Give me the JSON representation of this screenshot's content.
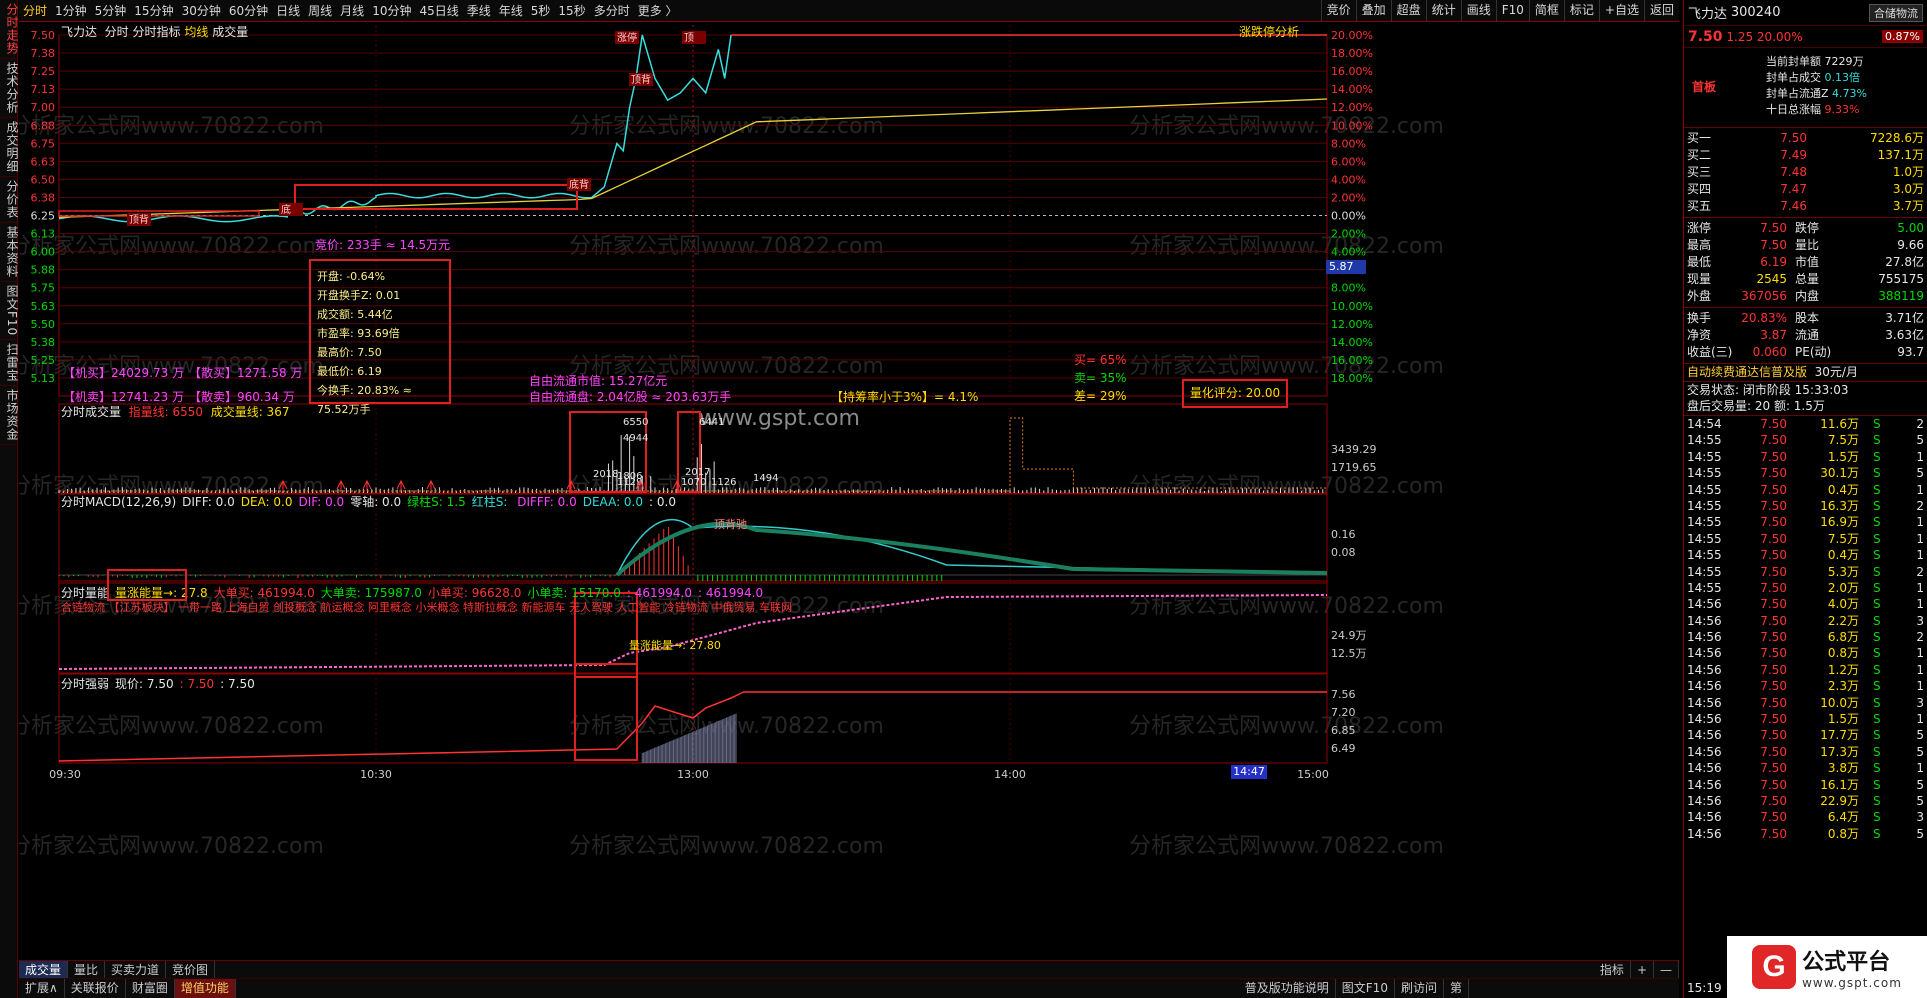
{
  "left_tabs": [
    "分时走势",
    "技术分析",
    "成交明细",
    "分价表",
    "基本资料",
    "图文F10",
    "扫雷宝",
    "市场资金"
  ],
  "toolbar": {
    "periods": [
      "分时",
      "1分钟",
      "5分钟",
      "15分钟",
      "30分钟",
      "60分钟",
      "日线",
      "周线",
      "月线",
      "10分钟",
      "45日线",
      "季线",
      "年线",
      "5秒",
      "15秒",
      "多分时",
      "更多 〉"
    ],
    "right_buttons": [
      "竞价",
      "叠加",
      "超盘",
      "统计",
      "画线",
      "F10",
      "简框",
      "标记",
      "+自选",
      "返回"
    ]
  },
  "price_panel": {
    "title_items": [
      "飞力达",
      "分时",
      "分时指标",
      "均线",
      "成交量"
    ],
    "corner_label": "涨跌停分析",
    "y_prices": [
      "7.50",
      "7.38",
      "7.25",
      "7.13",
      "7.00",
      "6.88",
      "6.75",
      "6.63",
      "6.50",
      "6.38",
      "6.25",
      "6.13",
      "6.00",
      "5.88",
      "5.75",
      "5.63",
      "5.50",
      "5.38",
      "5.25",
      "5.13"
    ],
    "y_pcts": [
      "20.00%",
      "18.00%",
      "16.00%",
      "14.00%",
      "12.00%",
      "10.00%",
      "8.00%",
      "6.00%",
      "4.00%",
      "2.00%",
      "0.00%",
      "2.00%",
      "4.00%",
      "6.00%",
      "8.00%",
      "10.00%",
      "12.00%",
      "14.00%",
      "16.00%",
      "18.00%"
    ],
    "current_tag": "5.87",
    "bid_label": "竞价: 233手 ≈ 14.5万元",
    "info_box": [
      "开盘: -0.64%",
      "开盘换手Z: 0.01",
      "成交额: 5.44亿",
      "市盈率: 93.69倍",
      "最高价: 7.50",
      "最低价: 6.19",
      "今换手: 20.83% ≈ 75.52万手"
    ],
    "jimai": "【机买】24029.73 万",
    "sanmai": "【散买】1271.58 万",
    "jimai2": "【机卖】12741.23 万",
    "sanmai2": "【散卖】960.34 万",
    "float_mv": "自由流通市值: 15.27亿元",
    "float_shares": "自由流通盘: 2.04亿股 ≈ 203.63万手",
    "ratio_text": "【持筹率小于3%】= 4.1%",
    "buy_pct": "买= 65%",
    "sell_pct": "卖= 35%",
    "diff_pct": "差= 29%",
    "score": "量化评分: 20.00",
    "markers": [
      "顶背",
      "底",
      "底背",
      "涨停",
      "顶背",
      "顶"
    ]
  },
  "volume_panel": {
    "title": "分时成交量",
    "vol_a": "指量线: 6550",
    "vol_b": "成交量线: 367",
    "y_labels": [
      "3439.29",
      "1719.65"
    ],
    "bar_labels": [
      "6550",
      "4944",
      "2018",
      "1806",
      "2017",
      "1070",
      "1126",
      "1494",
      "6441",
      "1129"
    ]
  },
  "macd_panel": {
    "title": "分时MACD(12,26,9)",
    "items": [
      "DIFF: 0.0",
      "DEA: 0.0",
      "DIF: 0.0",
      "零轴: 0.0",
      "绿柱S: 1.5",
      "红柱S: ",
      "DIFFF: 0.0",
      "DEAA: 0.0",
      ": 0.0"
    ],
    "y_labels": [
      "0.16",
      "0.08"
    ],
    "marker": "顶背驰"
  },
  "energy_panel": {
    "title": "分时量能",
    "items": [
      "量涨能量→: 27.8",
      "大单买: 461994.0",
      "大单卖: 175987.0",
      "小单买: 96628.0",
      "小单卖: 15170.0",
      ": 461994.0",
      ": 461994.0"
    ],
    "concepts": "合链物流 【江苏板块】 一带一路 上海自贸 创投概念 航运概念 阿里概念 小米概念 特斯拉概念 新能源车 无人驾驶 人工智能 冷链物流 中俄贸易 车联网",
    "marker": "量涨能量→: 27.80",
    "y_labels": [
      "24.9万",
      "12.5万"
    ]
  },
  "strength_panel": {
    "title": "分时强弱",
    "items": [
      "现价: 7.50",
      ": 7.50",
      ": 7.50"
    ],
    "y_labels": [
      "7.56",
      "7.20",
      "6.85",
      "6.49"
    ]
  },
  "time_axis": [
    "09:30",
    "10:30",
    "13:00",
    "14:00",
    "15:00"
  ],
  "cursor_time": "14:47",
  "watermark": "分析家公式网www.70822.com",
  "watermark2": "www.gspt.com",
  "right_panel": {
    "stock_name": "飞力达",
    "stock_code": "300240",
    "sector": "合储物流",
    "price": "7.50",
    "change": "1.25",
    "pct": "20.00%",
    "sector_pct": "0.87%",
    "board_tag": "首板",
    "seal_amount": "当前封单额",
    "seal_amount_val": "7229万",
    "seal_ratio": "封单占成交",
    "seal_ratio_val": "0.13倍",
    "seal_float": "封单占流通Z",
    "seal_float_val": "4.73%",
    "ten_day": "十日总涨幅",
    "ten_day_val": "9.33%",
    "order_book": [
      {
        "label": "买一",
        "price": "7.50",
        "vol": "7228.6万"
      },
      {
        "label": "买二",
        "price": "7.49",
        "vol": "137.1万"
      },
      {
        "label": "买三",
        "price": "7.48",
        "vol": "1.0万"
      },
      {
        "label": "买四",
        "price": "7.47",
        "vol": "3.0万"
      },
      {
        "label": "买五",
        "price": "7.46",
        "vol": "3.7万"
      }
    ],
    "stats": [
      {
        "l1": "涨停",
        "v1": "7.50",
        "l2": "跌停",
        "v2": "5.00"
      },
      {
        "l1": "最高",
        "v1": "7.50",
        "l2": "量比",
        "v2": "9.66"
      },
      {
        "l1": "最低",
        "v1": "6.19",
        "l2": "市值",
        "v2": "27.8亿"
      },
      {
        "l1": "现量",
        "v1": "2545",
        "l2": "总量",
        "v2": "755175"
      },
      {
        "l1": "外盘",
        "v1": "367056",
        "l2": "内盘",
        "v2": "388119"
      }
    ],
    "stats2": [
      {
        "l1": "换手",
        "v1": "20.83%",
        "l2": "股本",
        "v2": "3.71亿"
      },
      {
        "l1": "净资",
        "v1": "3.87",
        "l2": "流通",
        "v2": "3.63亿"
      },
      {
        "l1": "收益(三)",
        "v1": "0.060",
        "l2": "PE(动)",
        "v2": "93.7"
      }
    ],
    "promo": "自动续费通达信普及版",
    "promo_price": "30元/月",
    "status": "交易状态: 闭市阶段 15:33:03",
    "after_hours": "盘后交易量: 20 额: 1.5万",
    "ticks": [
      {
        "t": "14:54",
        "p": "7.50",
        "v": "11.6万",
        "s": "S",
        "n": "2"
      },
      {
        "t": "14:55",
        "p": "7.50",
        "v": "7.5万",
        "s": "S",
        "n": "5"
      },
      {
        "t": "14:55",
        "p": "7.50",
        "v": "1.5万",
        "s": "S",
        "n": "1"
      },
      {
        "t": "14:55",
        "p": "7.50",
        "v": "30.1万",
        "s": "S",
        "n": "5"
      },
      {
        "t": "14:55",
        "p": "7.50",
        "v": "0.4万",
        "s": "S",
        "n": "1"
      },
      {
        "t": "14:55",
        "p": "7.50",
        "v": "16.3万",
        "s": "S",
        "n": "2"
      },
      {
        "t": "14:55",
        "p": "7.50",
        "v": "16.9万",
        "s": "S",
        "n": "1"
      },
      {
        "t": "14:55",
        "p": "7.50",
        "v": "7.5万",
        "s": "S",
        "n": "1"
      },
      {
        "t": "14:55",
        "p": "7.50",
        "v": "0.4万",
        "s": "S",
        "n": "1"
      },
      {
        "t": "14:55",
        "p": "7.50",
        "v": "5.3万",
        "s": "S",
        "n": "2"
      },
      {
        "t": "14:55",
        "p": "7.50",
        "v": "2.0万",
        "s": "S",
        "n": "1"
      },
      {
        "t": "14:56",
        "p": "7.50",
        "v": "4.0万",
        "s": "S",
        "n": "1"
      },
      {
        "t": "14:56",
        "p": "7.50",
        "v": "2.2万",
        "s": "S",
        "n": "3"
      },
      {
        "t": "14:56",
        "p": "7.50",
        "v": "6.8万",
        "s": "S",
        "n": "2"
      },
      {
        "t": "14:56",
        "p": "7.50",
        "v": "0.8万",
        "s": "S",
        "n": "1"
      },
      {
        "t": "14:56",
        "p": "7.50",
        "v": "1.2万",
        "s": "S",
        "n": "1"
      },
      {
        "t": "14:56",
        "p": "7.50",
        "v": "2.3万",
        "s": "S",
        "n": "1"
      },
      {
        "t": "14:56",
        "p": "7.50",
        "v": "10.0万",
        "s": "S",
        "n": "3"
      },
      {
        "t": "14:56",
        "p": "7.50",
        "v": "1.5万",
        "s": "S",
        "n": "1"
      },
      {
        "t": "14:56",
        "p": "7.50",
        "v": "17.7万",
        "s": "S",
        "n": "5"
      },
      {
        "t": "14:56",
        "p": "7.50",
        "v": "17.3万",
        "s": "S",
        "n": "5"
      },
      {
        "t": "14:56",
        "p": "7.50",
        "v": "3.8万",
        "s": "S",
        "n": "1"
      },
      {
        "t": "14:56",
        "p": "7.50",
        "v": "16.1万",
        "s": "S",
        "n": "5"
      },
      {
        "t": "14:56",
        "p": "7.50",
        "v": "22.9万",
        "s": "S",
        "n": "5"
      },
      {
        "t": "14:56",
        "p": "7.50",
        "v": "6.4万",
        "s": "S",
        "n": "3"
      },
      {
        "t": "14:56",
        "p": "7.50",
        "v": "0.8万",
        "s": "S",
        "n": "5"
      }
    ],
    "last_tick_time": "15:19"
  },
  "bottom_tabs": [
    "成交量",
    "量比",
    "买卖力道",
    "竞价图"
  ],
  "bottom_tabs2": [
    "扩展∧",
    "关联报价",
    "财富圈",
    "增值功能"
  ],
  "status_texts": [
    "普及版功能说明",
    "图文F10",
    "刷访问",
    "第"
  ],
  "bottom_right_btns": [
    "指标",
    "+",
    "—"
  ],
  "brand_text": "公式平台",
  "brand_url": "www.gspt.com",
  "brand_letter": "G"
}
